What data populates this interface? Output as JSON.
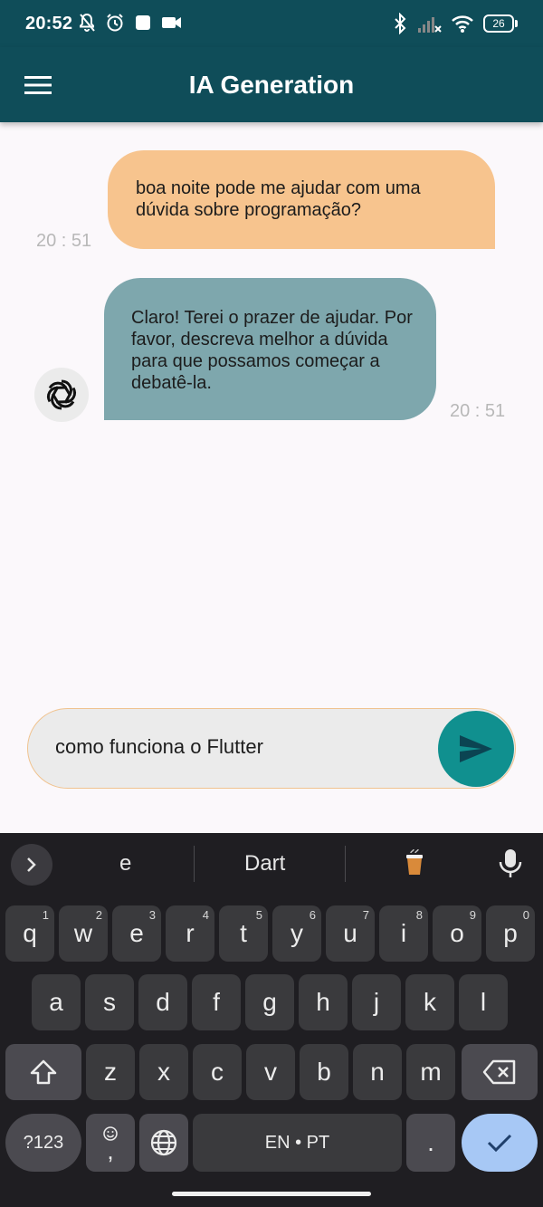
{
  "status_bar": {
    "time": "20:52",
    "battery": "26"
  },
  "app_bar": {
    "title": "IA Generation"
  },
  "chat": {
    "messages": [
      {
        "sender": "user",
        "text": "boa noite pode me ajudar com uma dúvida sobre programação?",
        "time": "20 : 51"
      },
      {
        "sender": "bot",
        "text": "Claro! Terei o prazer de ajudar. Por favor, descreva melhor a dúvida para que possamos começar a debatê-la.",
        "time": "20 : 51"
      }
    ]
  },
  "composer": {
    "value": "como funciona o Flutter"
  },
  "keyboard": {
    "suggestions": [
      "e",
      "Dart"
    ],
    "row1": [
      {
        "k": "q",
        "h": "1"
      },
      {
        "k": "w",
        "h": "2"
      },
      {
        "k": "e",
        "h": "3"
      },
      {
        "k": "r",
        "h": "4"
      },
      {
        "k": "t",
        "h": "5"
      },
      {
        "k": "y",
        "h": "6"
      },
      {
        "k": "u",
        "h": "7"
      },
      {
        "k": "i",
        "h": "8"
      },
      {
        "k": "o",
        "h": "9"
      },
      {
        "k": "p",
        "h": "0"
      }
    ],
    "row2": [
      "a",
      "s",
      "d",
      "f",
      "g",
      "h",
      "j",
      "k",
      "l"
    ],
    "row3": [
      "z",
      "x",
      "c",
      "v",
      "b",
      "n",
      "m"
    ],
    "symbols_label": "?123",
    "comma_label": ",",
    "space_label": "EN • PT",
    "period_label": "."
  },
  "colors": {
    "app_bar": "#0f4d59",
    "user_bubble": "#f7c48e",
    "bot_bubble": "#7ea7ad",
    "send_button": "#10908f",
    "keyboard_bg": "#1f1e22",
    "enter_key": "#a7c8f5"
  },
  "icons": {
    "menu": "hamburger-icon",
    "send": "send-icon",
    "avatar": "openai-logo-icon",
    "mic": "microphone-icon",
    "globe": "globe-icon",
    "shift": "shift-icon",
    "backspace": "backspace-icon",
    "enter": "checkmark-icon"
  }
}
